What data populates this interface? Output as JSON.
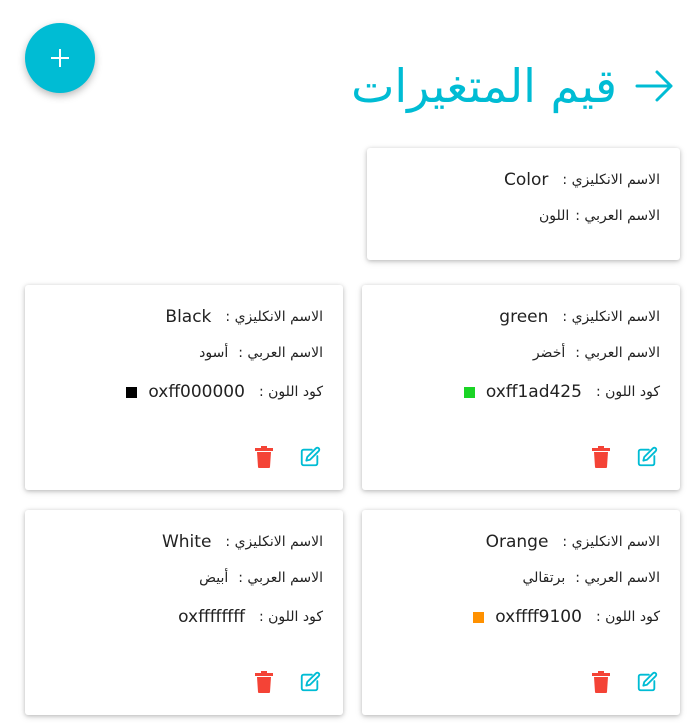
{
  "header": {
    "title": "قيم المتغيرات",
    "add_label": "+"
  },
  "colors": {
    "accent": "#00bcd4",
    "delete": "#f44336",
    "edit": "#00bcd4"
  },
  "category": {
    "en_label": "الاسم الانكليزي :",
    "en_value": "Color",
    "ar_label": "الاسم العربي :",
    "ar_value": "اللون"
  },
  "labels": {
    "en": "الاسم الانكليزي :",
    "ar": "الاسم العربي :",
    "code": "كود اللون :"
  },
  "items": [
    {
      "en": "green",
      "ar": "أخضر",
      "code": "oxff1ad425",
      "swatch": "#1ad425"
    },
    {
      "en": "Black",
      "ar": "أسود",
      "code": "oxff000000",
      "swatch": "#000000"
    },
    {
      "en": "Orange",
      "ar": "برتقالي",
      "code": "oxffff9100",
      "swatch": "#ff9100"
    },
    {
      "en": "White",
      "ar": "أبيض",
      "code": "oxffffffff",
      "swatch": "#ffffff"
    }
  ]
}
